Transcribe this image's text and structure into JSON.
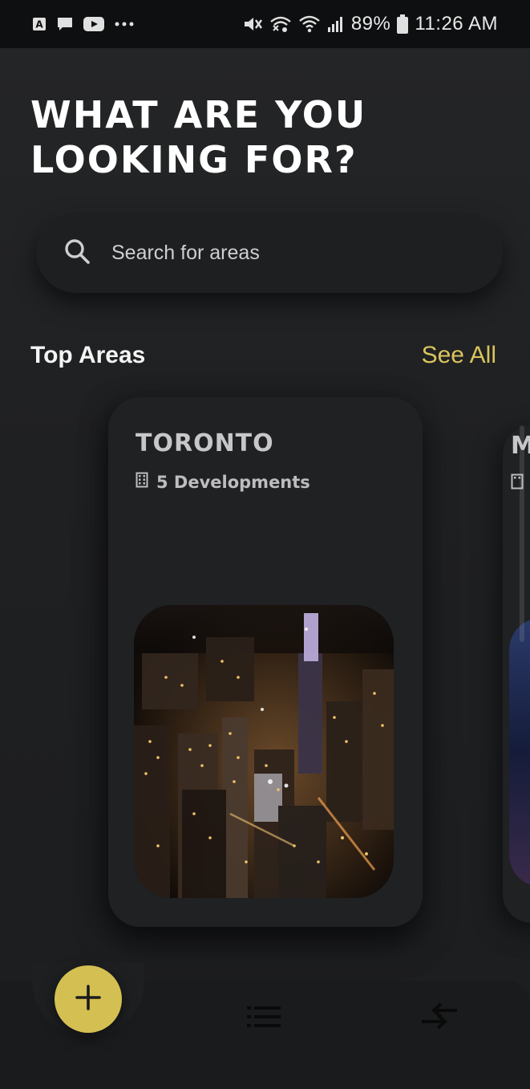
{
  "status_bar": {
    "battery": "89%",
    "time": "11:26 AM",
    "icons_left": [
      "app-a-icon",
      "message-icon",
      "youtube-icon",
      "more-dots-icon"
    ],
    "icons_right": [
      "mute-icon",
      "wifi-calling-icon",
      "wifi-icon",
      "signal-icon",
      "battery-icon"
    ]
  },
  "page": {
    "headline_line1": "WHAT ARE YOU",
    "headline_line2": "LOOKING FOR?"
  },
  "search": {
    "placeholder": "Search for areas",
    "icon": "search-icon"
  },
  "top_areas": {
    "title": "Top Areas",
    "see_all": "See All",
    "accent_color": "#d9c35d",
    "cards": [
      {
        "name": "TORONTO",
        "developments": "5 Developments",
        "icon": "building-icon",
        "image": "toronto-night-aerial"
      },
      {
        "name": "M",
        "icon": "building-icon",
        "image": "city-night-aerial"
      }
    ]
  },
  "bottom_nav": {
    "fab_icon": "plus-icon",
    "fab_color": "#d4bf52",
    "items": [
      {
        "icon": "list-icon"
      },
      {
        "icon": "compare-arrows-icon"
      }
    ]
  }
}
